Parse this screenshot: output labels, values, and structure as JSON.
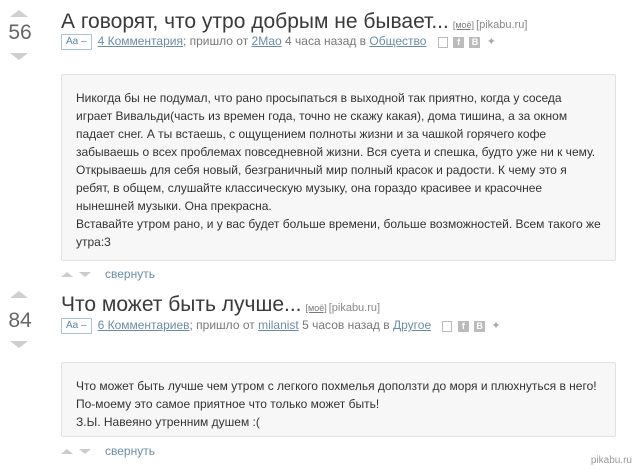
{
  "posts": [
    {
      "rating": "56",
      "title": "А говорят, что утро добрым не бывает...",
      "tag": "[моё]",
      "source": "[pikabu.ru]",
      "font_toggle": "Aa –",
      "comments": "4 Комментария",
      "came_from": "; пришло от",
      "author": "2Мао",
      "time": "4 часа назад в",
      "category": "Общество",
      "body": "Никогда бы не подумал, что рано просыпаться в выходной так приятно, когда у соседа играет Вивальди(часть из времен года, точно не скажу какая), дома тишина, а за окном падает снег. А ты встаешь, с ощущением полноты жизни и за чашкой горячего кофе забываешь о всех проблемах повседневной жизни. Вся суета и спешка, будто уже ни к чему. Открываешь для себя новый, безграничный мир полный красок и радости. К чему это я ребят, в общем, слушайте классическую музыку, она гораздо красивее и красочнее нынешней музыки. Она прекрасна.\nВставайте утром рано, и у вас будет больше времени, больше возможностей. Всем такого же утра:3",
      "collapse": "свернуть"
    },
    {
      "rating": "84",
      "title": "Что может быть лучше...",
      "tag": "[моё]",
      "source": "[pikabu.ru]",
      "font_toggle": "Aa –",
      "comments": "6 Комментариев",
      "came_from": "; пришло от",
      "author": "milanist",
      "time": "5 часов назад в",
      "category": "Другое",
      "body": "Что может быть лучше чем утром с легкого похмелья доползти до моря и плюхнуться в него! По-моему это самое приятное что только может быть!\nЗ.Ы. Навеяно утренним душем :(",
      "collapse": "свернуть"
    }
  ],
  "share_icons": [
    "save-icon",
    "facebook-icon",
    "vkontakte-icon",
    "twitter-icon"
  ],
  "watermark": "pikabu.ru"
}
